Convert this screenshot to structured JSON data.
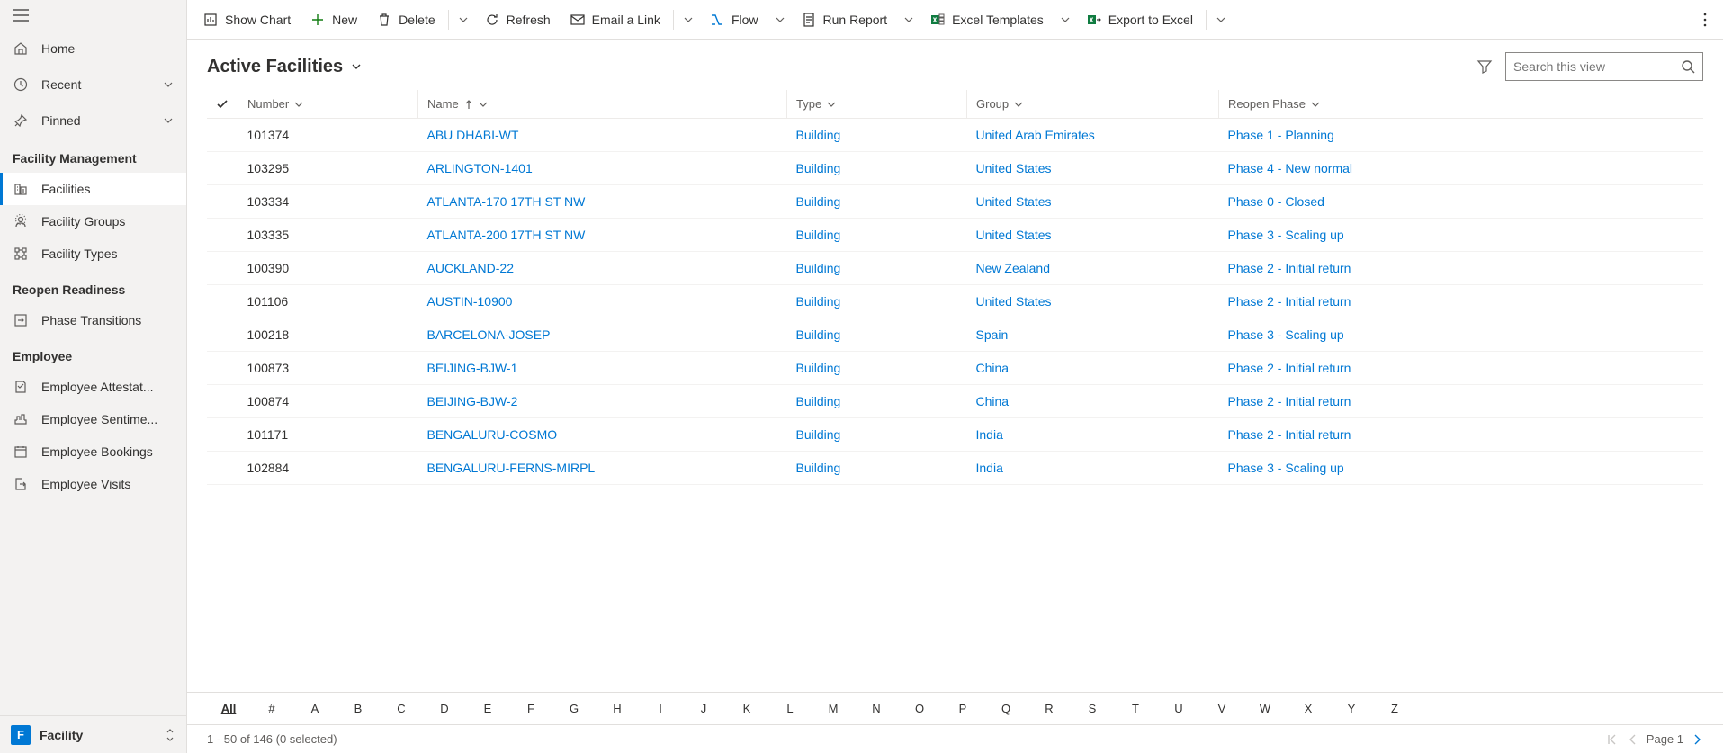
{
  "sidebar": {
    "home": "Home",
    "recent": "Recent",
    "pinned": "Pinned",
    "sections": [
      {
        "header": "Facility Management",
        "items": [
          {
            "label": "Facilities",
            "active": true
          },
          {
            "label": "Facility Groups"
          },
          {
            "label": "Facility Types"
          }
        ]
      },
      {
        "header": "Reopen Readiness",
        "items": [
          {
            "label": "Phase Transitions"
          }
        ]
      },
      {
        "header": "Employee",
        "items": [
          {
            "label": "Employee Attestat..."
          },
          {
            "label": "Employee Sentime..."
          },
          {
            "label": "Employee Bookings"
          },
          {
            "label": "Employee Visits"
          }
        ]
      }
    ],
    "footer": {
      "badge": "F",
      "label": "Facility"
    }
  },
  "commandBar": {
    "showChart": "Show Chart",
    "new": "New",
    "delete": "Delete",
    "refresh": "Refresh",
    "emailLink": "Email a Link",
    "flow": "Flow",
    "runReport": "Run Report",
    "excelTemplates": "Excel Templates",
    "exportExcel": "Export to Excel"
  },
  "view": {
    "title": "Active Facilities",
    "searchPlaceholder": "Search this view"
  },
  "columns": {
    "number": "Number",
    "name": "Name",
    "type": "Type",
    "group": "Group",
    "reopenPhase": "Reopen Phase"
  },
  "rows": [
    {
      "number": "101374",
      "name": "ABU DHABI-WT",
      "type": "Building",
      "group": "United Arab Emirates",
      "phase": "Phase 1 - Planning"
    },
    {
      "number": "103295",
      "name": "ARLINGTON-1401",
      "type": "Building",
      "group": "United States",
      "phase": "Phase 4 - New normal"
    },
    {
      "number": "103334",
      "name": "ATLANTA-170 17TH ST NW",
      "type": "Building",
      "group": "United States",
      "phase": "Phase 0 - Closed"
    },
    {
      "number": "103335",
      "name": "ATLANTA-200 17TH ST NW",
      "type": "Building",
      "group": "United States",
      "phase": "Phase 3 - Scaling up"
    },
    {
      "number": "100390",
      "name": "AUCKLAND-22",
      "type": "Building",
      "group": "New Zealand",
      "phase": "Phase 2 - Initial return"
    },
    {
      "number": "101106",
      "name": "AUSTIN-10900",
      "type": "Building",
      "group": "United States",
      "phase": "Phase 2 - Initial return"
    },
    {
      "number": "100218",
      "name": "BARCELONA-JOSEP",
      "type": "Building",
      "group": "Spain",
      "phase": "Phase 3 - Scaling up"
    },
    {
      "number": "100873",
      "name": "BEIJING-BJW-1",
      "type": "Building",
      "group": "China",
      "phase": "Phase 2 - Initial return"
    },
    {
      "number": "100874",
      "name": "BEIJING-BJW-2",
      "type": "Building",
      "group": "China",
      "phase": "Phase 2 - Initial return"
    },
    {
      "number": "101171",
      "name": "BENGALURU-COSMO",
      "type": "Building",
      "group": "India",
      "phase": "Phase 2 - Initial return"
    },
    {
      "number": "102884",
      "name": "BENGALURU-FERNS-MIRPL",
      "type": "Building",
      "group": "India",
      "phase": "Phase 3 - Scaling up"
    }
  ],
  "alphaBar": [
    "All",
    "#",
    "A",
    "B",
    "C",
    "D",
    "E",
    "F",
    "G",
    "H",
    "I",
    "J",
    "K",
    "L",
    "M",
    "N",
    "O",
    "P",
    "Q",
    "R",
    "S",
    "T",
    "U",
    "V",
    "W",
    "X",
    "Y",
    "Z"
  ],
  "status": {
    "range": "1 - 50 of 146 (0 selected)",
    "page": "Page 1"
  }
}
